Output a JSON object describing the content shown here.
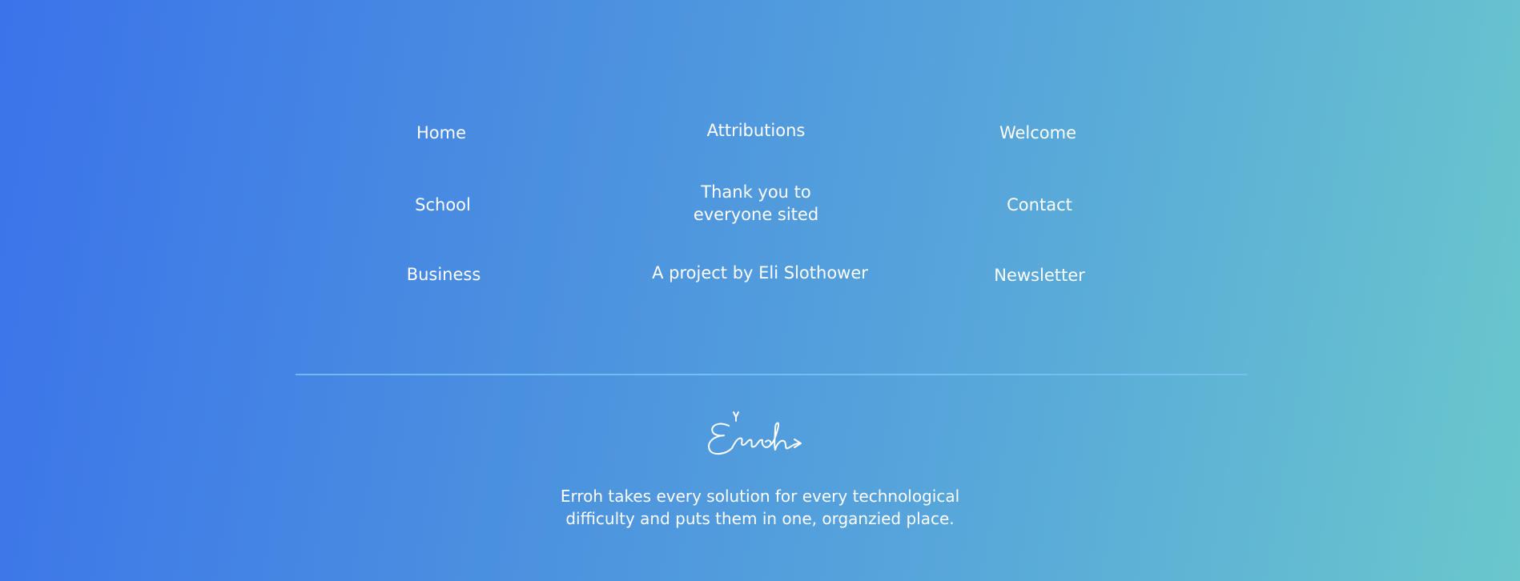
{
  "nav": {
    "left": {
      "home": "Home",
      "school": "School",
      "business": "Business"
    },
    "center": {
      "attributions": "Attributions",
      "thanks": "Thank you to everyone sited",
      "credit": "A project by Eli Slothower"
    },
    "right": {
      "welcome": "Welcome",
      "contact": "Contact",
      "newsletter": "Newsletter"
    }
  },
  "brand": {
    "logo_text": "Erroh",
    "tagline": "Erroh takes every solution for every technological difficulty and puts them in one, organzied place."
  },
  "colors": {
    "gradient_start": "#3b73ea",
    "gradient_end": "#6ac7cc",
    "divider": "#78c3f5",
    "text": "#ffffff"
  }
}
